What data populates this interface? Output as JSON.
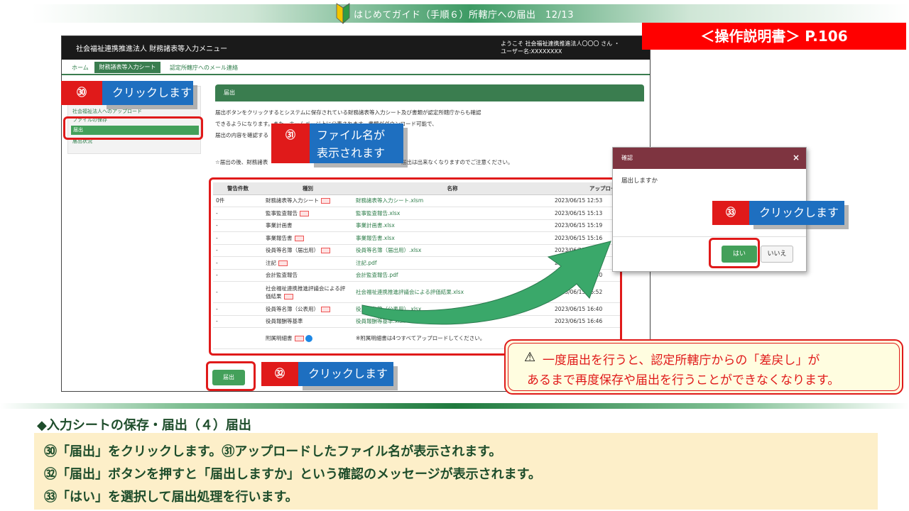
{
  "banner": {
    "title": "はじめてガイド（手順６）所轄庁への届出　12/13"
  },
  "manual_ref": "＜操作説明書＞ P.106",
  "app": {
    "title": "社会福祉連携推進法人 財務諸表等入力メニュー",
    "welcome_line1": "ようこそ 社会福祉連携推進法人〇〇〇 さん ・",
    "welcome_line2": "ユーザー名:XXXXXXXX",
    "nav": {
      "home": "ホーム",
      "active": "財務諸表等入力シート",
      "mail": "認定所轄庁へのメール連絡"
    },
    "sidebar": {
      "item1": "社会福祉法人へのアップロード",
      "item2": "ファイルの保存",
      "active": "届出",
      "item4": "届出状況"
    },
    "panel_title": "届出",
    "desc1": "届出ボタンをクリックするとシステムに保存されている財務諸表等入力シート及び書類が認定所轄庁からも確認",
    "desc2": "できるようになります。また、ホームページ上に公表されます。書類がダウンロード可能で、",
    "desc3": "届出の内容を確認する",
    "desc4": "☆届出の後、財務諸表",
    "desc5": "届出は出来なくなりますのでご注意ください。",
    "table": {
      "headers": [
        "警告件数",
        "種別",
        "名称",
        "アップロード"
      ],
      "rows": [
        {
          "warn": "0件",
          "type": "財務諸表等入力シート",
          "name": "財務諸表等入力シート.xlsm",
          "date": "2023/06/15 12:53"
        },
        {
          "warn": "-",
          "type": "監事監査報告",
          "name": "監事監査報告.xlsx",
          "date": "2023/06/15 15:13"
        },
        {
          "warn": "-",
          "type": "事業計画書",
          "name": "事業計画書.xlsx",
          "date": "2023/06/15 15:19"
        },
        {
          "warn": "-",
          "type": "事業報告書",
          "name": "事業報告書.xlsx",
          "date": "2023/06/15 15:16"
        },
        {
          "warn": "-",
          "type": "役員等名簿（届出用）",
          "name": "役員等名簿（届出用）.xlsx",
          "date": "2023/06/15 15:22"
        },
        {
          "warn": "-",
          "type": "注記",
          "name": "注記.pdf",
          "date": "2023/06/15 15:31"
        },
        {
          "warn": "-",
          "type": "会計監査報告",
          "name": "会計監査報告.pdf",
          "date": "2023/06/15 16:40"
        },
        {
          "warn": "-",
          "type": "社会福祉連携推進評議会による評価結果",
          "name": "社会福祉連携推進評議会による評価結果.xlsx",
          "date": "2023/06/15 16:52"
        },
        {
          "warn": "-",
          "type": "役員等名簿（公表用）",
          "name": "役員等名簿（公表用）.xlsx",
          "date": "2023/06/15 16:40"
        },
        {
          "warn": "-",
          "type": "役員報酬等基準",
          "name": "役員報酬等基準.xlsx",
          "date": "2023/06/15 16:46"
        },
        {
          "warn": "",
          "type": "附属明細書",
          "name": "※附属明細書は4つすべてアップロードしてください。",
          "date": ""
        }
      ]
    },
    "submit_button": "届出"
  },
  "callouts": {
    "c30": {
      "num": "㉚",
      "text": "クリックします"
    },
    "c31": {
      "num": "㉛",
      "text1": "ファイル名が",
      "text2": "表示されます"
    },
    "c32": {
      "num": "㉜",
      "text": "クリックします"
    },
    "c33": {
      "num": "㉝",
      "text": "クリックします"
    }
  },
  "dialog": {
    "title": "確認",
    "close": "×",
    "message": "届出しますか",
    "yes": "はい",
    "no": "いいえ"
  },
  "warning": {
    "line1": "一度届出を行うと、認定所轄庁からの「差戻し」が",
    "line2": "あるまで再度保存や届出を行うことができなくなります。"
  },
  "section_title": "◆入力シートの保存・届出（４）届出",
  "notes": [
    "㉚「届出」をクリックします。㉛アップロードしたファイル名が表示されます。",
    "㉜「届出」ボタンを押すと「届出しますか」という確認のメッセージが表示されます。",
    "㉝「はい」を選択して届出処理を行います。"
  ]
}
